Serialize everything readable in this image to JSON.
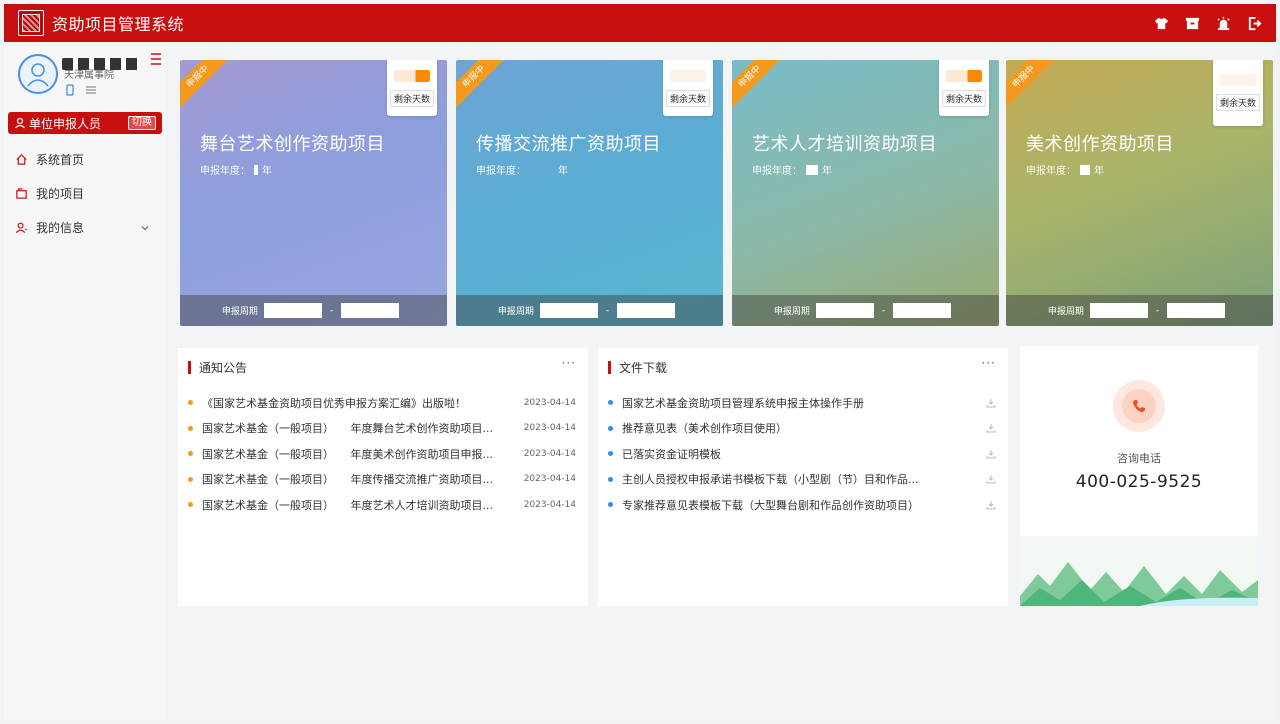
{
  "app": {
    "title": "资助项目管理系统"
  },
  "user": {
    "org": "天津属事院"
  },
  "sidebar": {
    "role": "单位申报人员",
    "switch_label": "切换",
    "items": [
      {
        "label": "系统首页",
        "icon": "home-icon"
      },
      {
        "label": "我的项目",
        "icon": "folder-icon"
      },
      {
        "label": "我的信息",
        "icon": "user-icon"
      }
    ]
  },
  "cards": [
    {
      "title": "舞台艺术创作资助项目",
      "ribbon": "申报中",
      "days_label": "剩余天数",
      "year_label": "申报年度：",
      "year_suffix": "年",
      "period_label": "申报周期",
      "color": "#8e9ad4"
    },
    {
      "title": "传播交流推广资助项目",
      "ribbon": "申报中",
      "days_label": "剩余天数",
      "year_label": "申报年度：",
      "year_suffix": "年",
      "period_label": "申报周期",
      "color": "#6aaed2"
    },
    {
      "title": "艺术人才培训资助项目",
      "ribbon": "申报中",
      "days_label": "剩余天数",
      "year_label": "申报年度：",
      "year_suffix": "年",
      "period_label": "申报周期",
      "color": "#8fb8a6"
    },
    {
      "title": "美术创作资助项目",
      "ribbon": "申报中",
      "days_label": "剩余天数",
      "year_label": "申报年度：",
      "year_suffix": "年",
      "period_label": "申报周期",
      "color": "#b8b765"
    }
  ],
  "notice": {
    "title": "通知公告",
    "more": "···",
    "items": [
      {
        "text": "《国家艺术基金资助项目优秀申报方案汇编》出版啦！",
        "date": "2023-04-14"
      },
      {
        "text": "国家艺术基金（一般项目）　　年度舞台艺术创作资助项目...",
        "date": "2023-04-14"
      },
      {
        "text": "国家艺术基金（一般项目）　　年度美术创作资助项目申报...",
        "date": "2023-04-14"
      },
      {
        "text": "国家艺术基金（一般项目）　　年度传播交流推广资助项目...",
        "date": "2023-04-14"
      },
      {
        "text": "国家艺术基金（一般项目）　　年度艺术人才培训资助项目...",
        "date": "2023-04-14"
      }
    ]
  },
  "downloads": {
    "title": "文件下载",
    "more": "···",
    "items": [
      {
        "text": "国家艺术基金资助项目管理系统申报主体操作手册"
      },
      {
        "text": "推荐意见表（美术创作项目使用）"
      },
      {
        "text": "已落实资金证明模板"
      },
      {
        "text": "主创人员授权申报承诺书模板下载（小型剧（节）目和作品..."
      },
      {
        "text": "专家推荐意见表模板下载（大型舞台剧和作品创作资助项目）"
      }
    ]
  },
  "contact": {
    "label": "咨询电话",
    "number": "400-025-9525"
  }
}
